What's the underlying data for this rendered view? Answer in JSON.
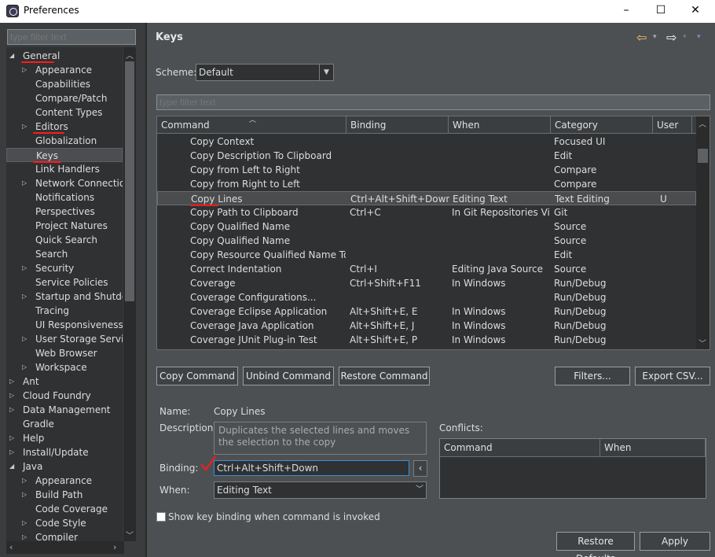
{
  "window": {
    "title": "Preferences",
    "minimize": "–",
    "maximize": "☐",
    "close": "✕"
  },
  "sidebar": {
    "filter_placeholder": "type filter text",
    "items": [
      {
        "label": "General",
        "arrow": "◢",
        "indent": 0
      },
      {
        "label": "Appearance",
        "arrow": "▷",
        "indent": 1
      },
      {
        "label": "Capabilities",
        "arrow": "",
        "indent": 1
      },
      {
        "label": "Compare/Patch",
        "arrow": "",
        "indent": 1
      },
      {
        "label": "Content Types",
        "arrow": "",
        "indent": 1
      },
      {
        "label": "Editors",
        "arrow": "▷",
        "indent": 1
      },
      {
        "label": "Globalization",
        "arrow": "",
        "indent": 1
      },
      {
        "label": "Keys",
        "arrow": "",
        "indent": 1,
        "selected": true
      },
      {
        "label": "Link Handlers",
        "arrow": "",
        "indent": 1
      },
      {
        "label": "Network Connections",
        "arrow": "▷",
        "indent": 1
      },
      {
        "label": "Notifications",
        "arrow": "",
        "indent": 1
      },
      {
        "label": "Perspectives",
        "arrow": "",
        "indent": 1
      },
      {
        "label": "Project Natures",
        "arrow": "",
        "indent": 1
      },
      {
        "label": "Quick Search",
        "arrow": "",
        "indent": 1
      },
      {
        "label": "Search",
        "arrow": "",
        "indent": 1
      },
      {
        "label": "Security",
        "arrow": "▷",
        "indent": 1
      },
      {
        "label": "Service Policies",
        "arrow": "",
        "indent": 1
      },
      {
        "label": "Startup and Shutdown",
        "arrow": "▷",
        "indent": 1
      },
      {
        "label": "Tracing",
        "arrow": "",
        "indent": 1
      },
      {
        "label": "UI Responsiveness Monitoring",
        "arrow": "",
        "indent": 1
      },
      {
        "label": "User Storage Service",
        "arrow": "▷",
        "indent": 1
      },
      {
        "label": "Web Browser",
        "arrow": "",
        "indent": 1
      },
      {
        "label": "Workspace",
        "arrow": "▷",
        "indent": 1
      },
      {
        "label": "Ant",
        "arrow": "▷",
        "indent": 0
      },
      {
        "label": "Cloud Foundry",
        "arrow": "▷",
        "indent": 0
      },
      {
        "label": "Data Management",
        "arrow": "▷",
        "indent": 0
      },
      {
        "label": "Gradle",
        "arrow": "",
        "indent": 0
      },
      {
        "label": "Help",
        "arrow": "▷",
        "indent": 0
      },
      {
        "label": "Install/Update",
        "arrow": "▷",
        "indent": 0
      },
      {
        "label": "Java",
        "arrow": "◢",
        "indent": 0
      },
      {
        "label": "Appearance",
        "arrow": "▷",
        "indent": 1
      },
      {
        "label": "Build Path",
        "arrow": "▷",
        "indent": 1
      },
      {
        "label": "Code Coverage",
        "arrow": "",
        "indent": 1
      },
      {
        "label": "Code Style",
        "arrow": "▷",
        "indent": 1
      },
      {
        "label": "Compiler",
        "arrow": "▷",
        "indent": 1
      }
    ]
  },
  "page": {
    "title": "Keys",
    "nav": {
      "back": "⇦",
      "forward": "⇨",
      "menu": "▾"
    },
    "scheme_label": "Scheme:",
    "scheme_value": "Default",
    "filter_placeholder": "type filter text",
    "columns": [
      "Command",
      "Binding",
      "When",
      "Category",
      "User"
    ],
    "rows": [
      [
        "Copy Context",
        "",
        "",
        "Focused UI",
        ""
      ],
      [
        "Copy Description To Clipboard",
        "",
        "",
        "Edit",
        ""
      ],
      [
        "Copy from Left to Right",
        "",
        "",
        "Compare",
        ""
      ],
      [
        "Copy from Right to Left",
        "",
        "",
        "Compare",
        ""
      ],
      [
        "Copy Lines",
        "Ctrl+Alt+Shift+Down",
        "Editing Text",
        "Text Editing",
        "U"
      ],
      [
        "Copy Path to Clipboard",
        "Ctrl+C",
        "In Git Repositories Vi...",
        "Git",
        ""
      ],
      [
        "Copy Qualified Name",
        "",
        "",
        "Source",
        ""
      ],
      [
        "Copy Qualified Name",
        "",
        "",
        "Source",
        ""
      ],
      [
        "Copy Resource Qualified Name To Clipboard",
        "",
        "",
        "Edit",
        ""
      ],
      [
        "Correct Indentation",
        "Ctrl+I",
        "Editing Java Source",
        "Source",
        ""
      ],
      [
        "Coverage",
        "Ctrl+Shift+F11",
        "In Windows",
        "Run/Debug",
        ""
      ],
      [
        "Coverage Configurations...",
        "",
        "",
        "Run/Debug",
        ""
      ],
      [
        "Coverage Eclipse Application",
        "Alt+Shift+E, E",
        "In Windows",
        "Run/Debug",
        ""
      ],
      [
        "Coverage Java Application",
        "Alt+Shift+E, J",
        "In Windows",
        "Run/Debug",
        ""
      ],
      [
        "Coverage JUnit Plug-in Test",
        "Alt+Shift+E, P",
        "In Windows",
        "Run/Debug",
        ""
      ]
    ],
    "selected_row": 4,
    "buttons": {
      "copy": "Copy Command",
      "unbind": "Unbind Command",
      "restore": "Restore Command",
      "filters": "Filters...",
      "export": "Export CSV..."
    },
    "details": {
      "name_label": "Name:",
      "name_value": "Copy Lines",
      "description_label": "Description:",
      "description_value": "Duplicates the selected lines and moves the selection to the copy",
      "binding_label": "Binding:",
      "binding_value": "Ctrl+Alt+Shift+Down",
      "when_label": "When:",
      "when_value": "Editing Text",
      "conflicts_label": "Conflicts:",
      "conflicts_columns": [
        "Command",
        "When"
      ],
      "show_binding_label": "Show key binding when command is invoked"
    },
    "footer": {
      "restore_defaults": "Restore Defaults",
      "apply": "Apply"
    }
  }
}
